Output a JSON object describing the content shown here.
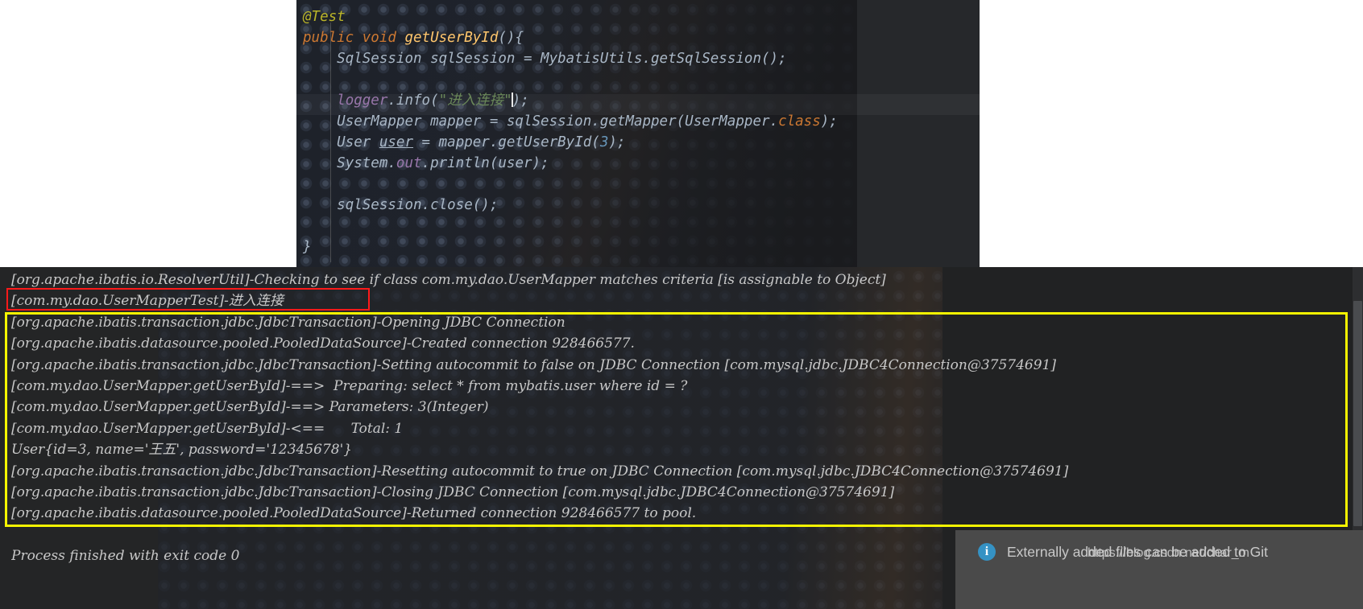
{
  "editor": {
    "language": "java",
    "caret_line_index": 4,
    "colors": {
      "background": "#2b2b2b",
      "annotation": "#bbb529",
      "keyword": "#cc7832",
      "method": "#ffc66d",
      "string": "#6a8759",
      "number": "#6897bb",
      "field": "#9876aa",
      "default_text": "#a9b7c6"
    },
    "code_lines": [
      "@Test",
      "public void getUserById(){",
      "    SqlSession sqlSession = MybatisUtils.getSqlSession();",
      "",
      "    logger.info(\"进入连接\");",
      "    UserMapper mapper = sqlSession.getMapper(UserMapper.class);",
      "    User user = mapper.getUserById(3);",
      "    System.out.println(user);",
      "",
      "    sqlSession.close();",
      "",
      "}"
    ],
    "tokens": {
      "annotation_test": "@Test",
      "kw_public": "public",
      "kw_void": "void",
      "method_name": "getUserById",
      "type_sqlsession": "SqlSession",
      "var_sqlsession": "sqlSession",
      "class_mybatisutils": "MybatisUtils",
      "method_getsqlsession": "getSqlSession",
      "field_logger": "logger",
      "method_info": "info",
      "string_chinese": "\"进入连接\"",
      "type_usermapper": "UserMapper",
      "var_mapper": "mapper",
      "method_getmapper": "getMapper",
      "kw_class": "class",
      "type_user": "User",
      "var_user": "user",
      "method_getuserbyid": "getUserById",
      "num_3": "3",
      "class_system": "System",
      "field_out": "out",
      "method_println": "println",
      "method_close": "close"
    }
  },
  "console": {
    "font_color": "#c8c8c8",
    "background": "#232425",
    "highlight_red": "#ff1a1a",
    "highlight_yellow": "#f5f500",
    "lines": [
      "[org.apache.ibatis.io.ResolverUtil]-Checking to see if class com.my.dao.UserMapper matches criteria [is assignable to Object]",
      "[com.my.dao.UserMapperTest]-进入连接",
      "[org.apache.ibatis.transaction.jdbc.JdbcTransaction]-Opening JDBC Connection",
      "[org.apache.ibatis.datasource.pooled.PooledDataSource]-Created connection 928466577.",
      "[org.apache.ibatis.transaction.jdbc.JdbcTransaction]-Setting autocommit to false on JDBC Connection [com.mysql.jdbc.JDBC4Connection@37574691]",
      "[com.my.dao.UserMapper.getUserById]-==>  Preparing: select * from mybatis.user where id = ?",
      "[com.my.dao.UserMapper.getUserById]-==> Parameters: 3(Integer)",
      "[com.my.dao.UserMapper.getUserById]-<==      Total: 1",
      "User{id=3, name='王五', password='12345678'}",
      "[org.apache.ibatis.transaction.jdbc.JdbcTransaction]-Resetting autocommit to true on JDBC Connection [com.mysql.jdbc.JDBC4Connection@37574691]",
      "[org.apache.ibatis.transaction.jdbc.JdbcTransaction]-Closing JDBC Connection [com.mysql.jdbc.JDBC4Connection@37574691]",
      "[org.apache.ibatis.datasource.pooled.PooledDataSource]-Returned connection 928466577 to pool.",
      "",
      "Process finished with exit code 0"
    ],
    "red_highlight_line_index": 1,
    "yellow_highlight_from_index": 2,
    "yellow_highlight_to_index": 11,
    "exit_status": "Process finished with exit code 0"
  },
  "notification": {
    "icon": "info-icon",
    "icon_glyph": "i",
    "message": "Externally added files can be added to Git",
    "background": "#4a4a4a",
    "icon_color": "#3592c4"
  },
  "watermark": {
    "text": "https://blog.csdn.net/char_m"
  }
}
